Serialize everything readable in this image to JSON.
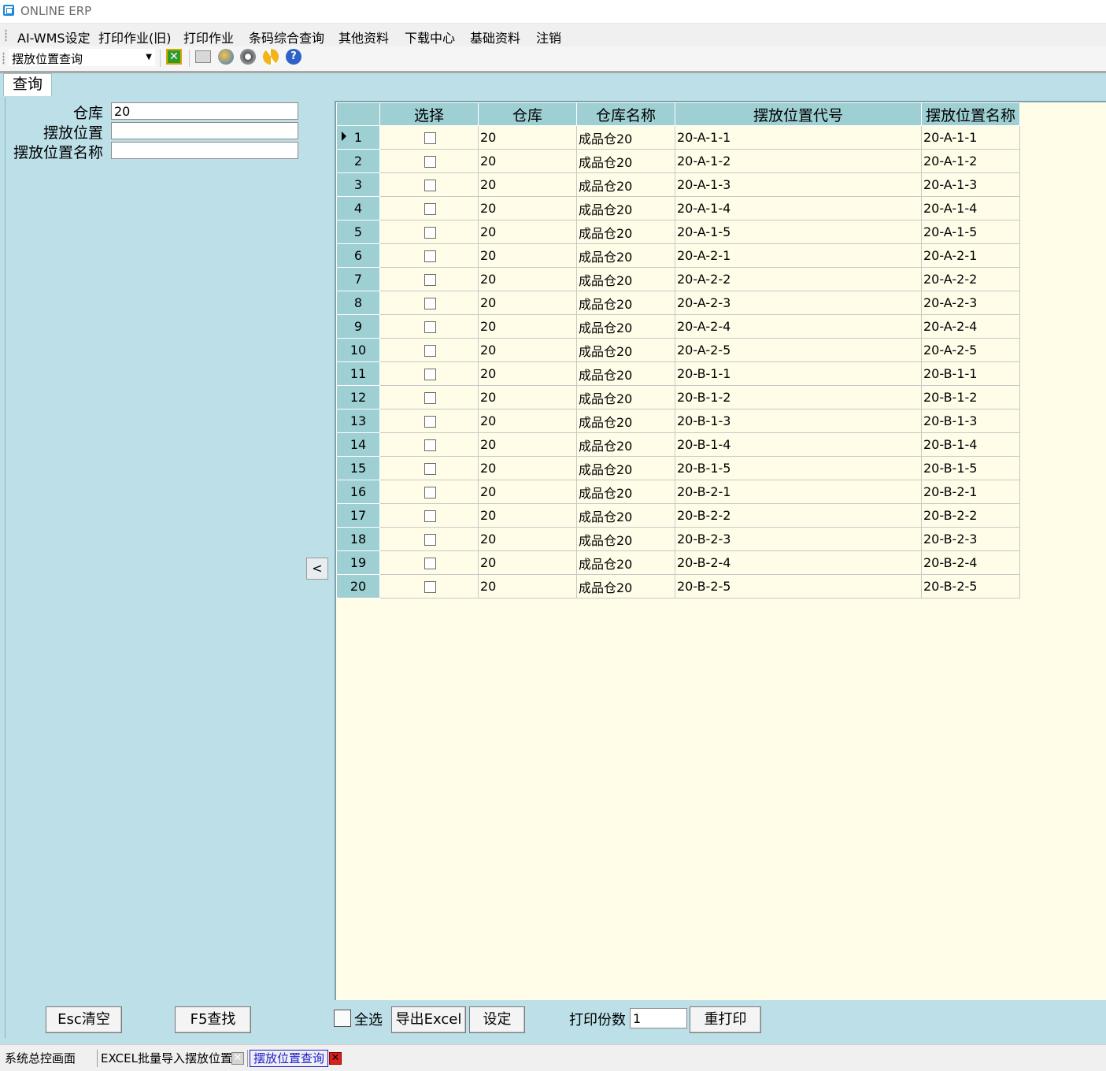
{
  "app": {
    "title": "ONLINE ERP"
  },
  "menu": [
    "AI-WMS设定",
    "打印作业(旧)",
    "打印作业",
    "条码综合查询",
    "其他资料",
    "下载中心",
    "基础资料",
    "注销"
  ],
  "toolbar": {
    "combo_value": "摆放位置查询"
  },
  "tab": {
    "label": "查询"
  },
  "filters": {
    "warehouse_label": "仓库",
    "warehouse_value": "20",
    "location_label": "摆放位置",
    "location_value": "",
    "location_name_label": "摆放位置名称",
    "location_name_value": ""
  },
  "collapse_label": "<",
  "grid": {
    "columns": [
      "选择",
      "仓库",
      "仓库名称",
      "摆放位置代号",
      "摆放位置名称"
    ],
    "rows": [
      [
        "1",
        "20",
        "成品仓20",
        "20-A-1-1",
        "20-A-1-1"
      ],
      [
        "2",
        "20",
        "成品仓20",
        "20-A-1-2",
        "20-A-1-2"
      ],
      [
        "3",
        "20",
        "成品仓20",
        "20-A-1-3",
        "20-A-1-3"
      ],
      [
        "4",
        "20",
        "成品仓20",
        "20-A-1-4",
        "20-A-1-4"
      ],
      [
        "5",
        "20",
        "成品仓20",
        "20-A-1-5",
        "20-A-1-5"
      ],
      [
        "6",
        "20",
        "成品仓20",
        "20-A-2-1",
        "20-A-2-1"
      ],
      [
        "7",
        "20",
        "成品仓20",
        "20-A-2-2",
        "20-A-2-2"
      ],
      [
        "8",
        "20",
        "成品仓20",
        "20-A-2-3",
        "20-A-2-3"
      ],
      [
        "9",
        "20",
        "成品仓20",
        "20-A-2-4",
        "20-A-2-4"
      ],
      [
        "10",
        "20",
        "成品仓20",
        "20-A-2-5",
        "20-A-2-5"
      ],
      [
        "11",
        "20",
        "成品仓20",
        "20-B-1-1",
        "20-B-1-1"
      ],
      [
        "12",
        "20",
        "成品仓20",
        "20-B-1-2",
        "20-B-1-2"
      ],
      [
        "13",
        "20",
        "成品仓20",
        "20-B-1-3",
        "20-B-1-3"
      ],
      [
        "14",
        "20",
        "成品仓20",
        "20-B-1-4",
        "20-B-1-4"
      ],
      [
        "15",
        "20",
        "成品仓20",
        "20-B-1-5",
        "20-B-1-5"
      ],
      [
        "16",
        "20",
        "成品仓20",
        "20-B-2-1",
        "20-B-2-1"
      ],
      [
        "17",
        "20",
        "成品仓20",
        "20-B-2-2",
        "20-B-2-2"
      ],
      [
        "18",
        "20",
        "成品仓20",
        "20-B-2-3",
        "20-B-2-3"
      ],
      [
        "19",
        "20",
        "成品仓20",
        "20-B-2-4",
        "20-B-2-4"
      ],
      [
        "20",
        "20",
        "成品仓20",
        "20-B-2-5",
        "20-B-2-5"
      ]
    ]
  },
  "buttons": {
    "esc_clear": "Esc清空",
    "f5_find": "F5查找",
    "select_all": "全选",
    "export_excel": "导出Excel",
    "settings": "设定",
    "print_copies_label": "打印份数",
    "print_copies_value": "1",
    "reprint": "重打印"
  },
  "window_tabs": [
    "系统总控画面",
    "EXCEL批量导入摆放位置",
    "摆放位置查询"
  ],
  "colors": {
    "accent": "#1a88d8",
    "panel": "#bcdfe8",
    "grid_header": "#9ecfd3",
    "grid_bg": "#fffde8",
    "active_tab_text": "#1b1bd0",
    "close_red": "#d9201b"
  }
}
